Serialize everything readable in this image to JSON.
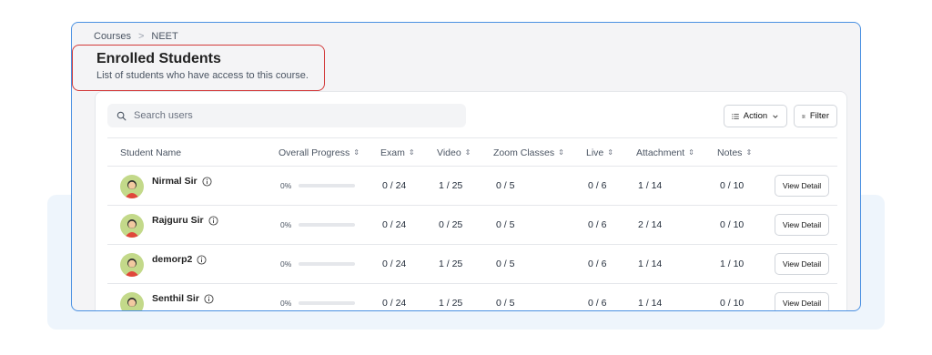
{
  "breadcrumb": {
    "items": [
      "Courses",
      "NEET"
    ],
    "separator": ">"
  },
  "header": {
    "title": "Enrolled Students",
    "subtitle": "List of students who have access to this course."
  },
  "search": {
    "placeholder": "Search users",
    "value": ""
  },
  "toolbar": {
    "action_label": "Action",
    "filter_label": "Filter"
  },
  "table": {
    "columns": [
      "Student Name",
      "Overall Progress",
      "Exam",
      "Video",
      "Zoom Classes",
      "Live",
      "Attachment",
      "Notes"
    ],
    "view_label": "View Detail",
    "rows": [
      {
        "name": "Nirmal Sir",
        "progress_label": "0%",
        "progress": 0,
        "exam": "0 / 24",
        "video": "1 / 25",
        "zoom": "0 / 5",
        "live": "0 / 6",
        "attachment": "1 / 14",
        "notes": "0 / 10"
      },
      {
        "name": "Rajguru Sir",
        "progress_label": "0%",
        "progress": 0,
        "exam": "0 / 24",
        "video": "0 / 25",
        "zoom": "0 / 5",
        "live": "0 / 6",
        "attachment": "2 / 14",
        "notes": "0 / 10"
      },
      {
        "name": "demorp2",
        "progress_label": "0%",
        "progress": 0,
        "exam": "0 / 24",
        "video": "1 / 25",
        "zoom": "0 / 5",
        "live": "0 / 6",
        "attachment": "1 / 14",
        "notes": "1 / 10"
      },
      {
        "name": "Senthil Sir",
        "progress_label": "0%",
        "progress": 0,
        "exam": "0 / 24",
        "video": "1 / 25",
        "zoom": "0 / 5",
        "live": "0 / 6",
        "attachment": "1 / 14",
        "notes": "0 / 10"
      }
    ]
  },
  "colors": {
    "accent": "#4a90e2",
    "highlight_border": "#d23a3a",
    "avatar_bg": "#c3d98a"
  }
}
